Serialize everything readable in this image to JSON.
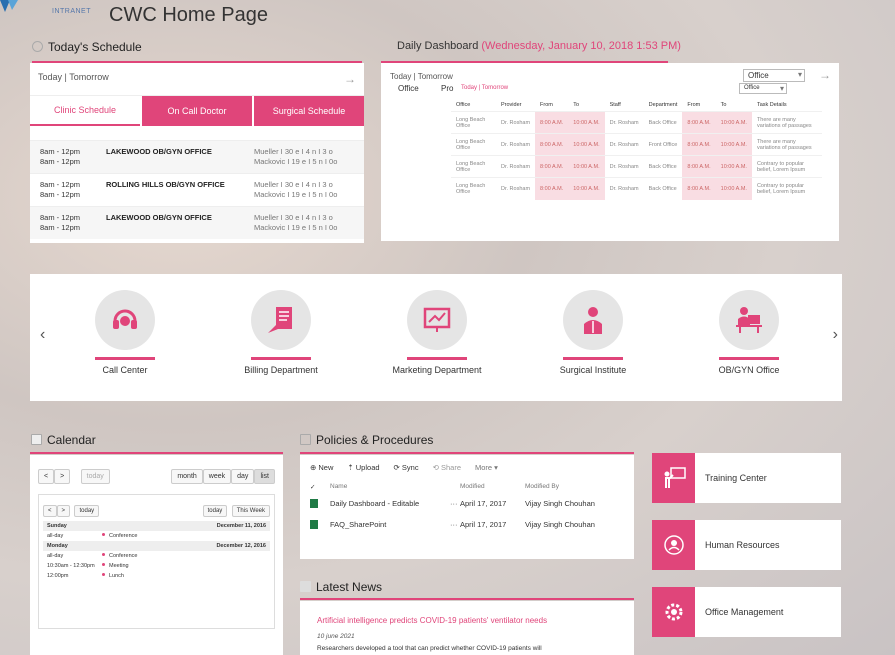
{
  "header": {
    "brand_sub": "INTRANET",
    "title": "CWC Home Page"
  },
  "schedule": {
    "title": "Today's Schedule",
    "tabs_today": "Today | Tomorrow",
    "arrow": "→",
    "tabs": [
      "Clinic Schedule",
      "On Call Doctor",
      "Surgical Schedule"
    ],
    "rows": [
      {
        "time": "8am - 12pm\n8am - 12pm",
        "office": "LAKEWOOD OB/GYN OFFICE",
        "docs": "Mueller I 30 e I 4 n I 3 o\nMackovic I 19 e I 5 n I 0o"
      },
      {
        "time": "8am - 12pm\n8am - 12pm",
        "office": "ROLLING HILLS OB/GYN OFFICE",
        "docs": "Mueller I 30 e I 4 n I 3 o\nMackovic I 19 e I 5 n I 0o"
      },
      {
        "time": "8am - 12pm\n8am - 12pm",
        "office": "LAKEWOOD OB/GYN OFFICE",
        "docs": "Mueller I 30 e I 4 n I 3 o\nMackovic I 19 e I 5 n I 0o"
      }
    ]
  },
  "dashboard": {
    "title": "Daily Dashboard",
    "date": "(Wednesday, January 10, 2018 1:53 PM)",
    "tabs_today": "Today | Tomorrow",
    "office_label": "Office",
    "pro_label": "Pro",
    "filter_value": "Office",
    "inner_filter_value": "Office",
    "arrow": "→",
    "columns": [
      "Office",
      "Provider",
      "From",
      "To",
      "Staff",
      "Department",
      "From",
      "To",
      "Task Details"
    ],
    "rows": [
      [
        "Long Beach Office",
        "Dr. Rosham",
        "8:00 A.M.",
        "10:00 A.M.",
        "Dr. Rosham",
        "Back Office",
        "8:00 A.M.",
        "10:00 A.M.",
        "There are many variations of passages"
      ],
      [
        "Long Beach Office",
        "Dr. Rosham",
        "8:00 A.M.",
        "10:00 A.M.",
        "Dr. Rosham",
        "Front Office",
        "8:00 A.M.",
        "10:00 A.M.",
        "There are many variations of passages"
      ],
      [
        "Long Beach Office",
        "Dr. Rosham",
        "8:00 A.M.",
        "10:00 A.M.",
        "Dr. Rosham",
        "Back Office",
        "8:00 A.M.",
        "10:00 A.M.",
        "Contrary to popular belief, Lorem Ipsum"
      ],
      [
        "Long Beach Office",
        "Dr. Rosham",
        "8:00 A.M.",
        "10:00 A.M.",
        "Dr. Rosham",
        "Back Office",
        "8:00 A.M.",
        "10:00 A.M.",
        "Contrary to popular belief, Lorem Ipsum"
      ]
    ]
  },
  "departments": {
    "prev": "‹",
    "next": "›",
    "items": [
      {
        "name": "Call Center",
        "icon": "headset-icon"
      },
      {
        "name": "Billing Department",
        "icon": "billing-icon"
      },
      {
        "name": "Marketing Department",
        "icon": "chart-board-icon"
      },
      {
        "name": "Surgical Institute",
        "icon": "surgeon-icon"
      },
      {
        "name": "OB/GYN Office",
        "icon": "desk-icon"
      }
    ]
  },
  "calendar": {
    "title": "Calendar",
    "prev": "<",
    "next": ">",
    "today": "today",
    "views": [
      "month",
      "week",
      "day",
      "list"
    ],
    "inner_today": "today",
    "inner_this_week": "This Week",
    "days": [
      {
        "label": "Sunday",
        "date": "December 11, 2016",
        "events": [
          {
            "time": "all-day",
            "name": "Conference"
          }
        ]
      },
      {
        "label": "Monday",
        "date": "December 12, 2016",
        "events": [
          {
            "time": "all-day",
            "name": "Conference"
          },
          {
            "time": "10:30am - 12:30pm",
            "name": "Meeting"
          },
          {
            "time": "12:00pm",
            "name": "Lunch"
          }
        ]
      }
    ]
  },
  "policies": {
    "title": "Policies & Procedures",
    "toolbar": [
      "New",
      "Upload",
      "Sync",
      "Share",
      "More"
    ],
    "headers": {
      "name": "Name",
      "modified": "Modified",
      "modified_by": "Modified By"
    },
    "files": [
      {
        "name": "Daily Dashboard - Editable",
        "modified": "April 17, 2017",
        "by": "Vijay Singh Chouhan"
      },
      {
        "name": "FAQ_SharePoint",
        "modified": "April 17, 2017",
        "by": "Vijay Singh Chouhan"
      }
    ]
  },
  "news": {
    "title": "Latest News",
    "headline": "Artificial intelligence predicts COVID-19 patients' ventilator needs",
    "date": "10 june 2021",
    "text": "Researchers developed a tool that can predict whether COVID-19 patients will"
  },
  "tiles": [
    "Training Center",
    "Human Resources",
    "Office Management"
  ],
  "colors": {
    "accent": "#e0457a"
  }
}
